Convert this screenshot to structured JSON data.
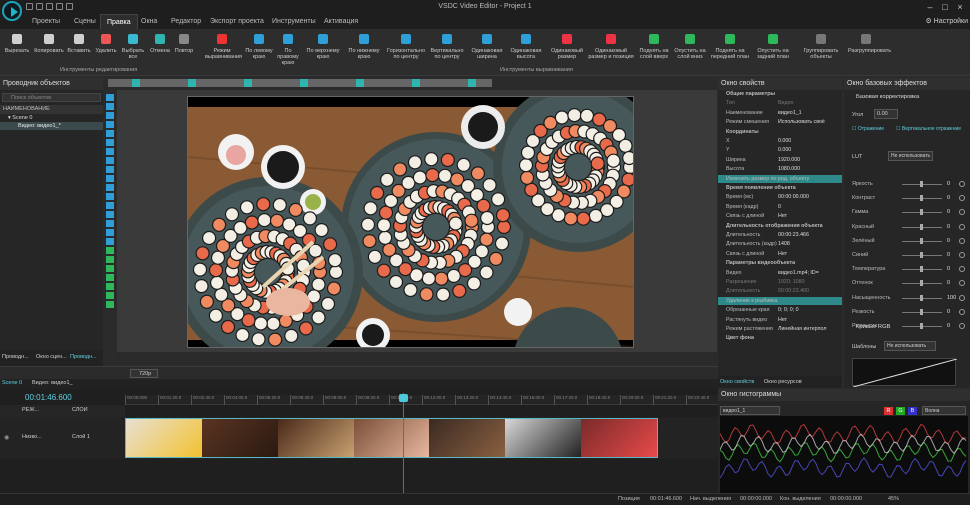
{
  "window": {
    "title": "VSDC Video Editor - Project 1",
    "settings": "Настройки"
  },
  "menu": [
    "Проекты",
    "Сцены",
    "Правка",
    "Окна",
    "Редактор",
    "Экспорт проекта",
    "Инструменты",
    "Активация"
  ],
  "ribbon": {
    "buttons": [
      "Вырезать",
      "Копировать",
      "Вставить",
      "Удалить",
      "Выбрать все",
      "Отмена",
      "Повтор",
      "Режим выравнивания",
      "По левому краю",
      "По правому краю",
      "По верхнему краю",
      "По нижнему краю",
      "Горизонтально по центру",
      "Вертикально по центру",
      "Одинаковая ширина",
      "Одинаковая высота",
      "Одинаковый размер",
      "Одинаковый размер и позиция",
      "Поднять на слой вверх",
      "Опустить на слой вниз",
      "Поднять на передний план",
      "Опустить на задний план",
      "Группировать объекты",
      "Разгруппировать"
    ],
    "groups": [
      "Инструменты редактирования",
      "Инструменты выравнивания"
    ]
  },
  "explorer": {
    "title": "Проводник объектов",
    "search": "Поиск объектов",
    "header": "НАИМЕНОВАНИЕ",
    "scene": "Scene 0",
    "item": "Видео: видео1_*",
    "tab1": "Проводн...",
    "tab2": "Окно сцен...",
    "tab3": "Проводн..."
  },
  "props": {
    "title": "Окно свойств",
    "rows": [
      {
        "k": "Общие параметры",
        "v": "",
        "t": "sect"
      },
      {
        "k": "Тип",
        "v": "Видео",
        "t": "dim"
      },
      {
        "k": "Наименование",
        "v": "видео1_1",
        "t": ""
      },
      {
        "k": "Режим смешения",
        "v": "Использовать своё",
        "t": ""
      },
      {
        "k": "Координаты",
        "v": "",
        "t": "sect"
      },
      {
        "k": "X",
        "v": "0.000",
        "t": ""
      },
      {
        "k": "Y",
        "v": "0.000",
        "t": ""
      },
      {
        "k": "Ширина",
        "v": "1920.000",
        "t": ""
      },
      {
        "k": "Высота",
        "v": "1080.000",
        "t": ""
      },
      {
        "k": "Изменить размер по род. объекту",
        "v": "",
        "t": "hl"
      },
      {
        "k": "Время появления объекта",
        "v": "",
        "t": "sect"
      },
      {
        "k": "Время (мс)",
        "v": "00:00:00.000",
        "t": ""
      },
      {
        "k": "Время (кадр)",
        "v": "0",
        "t": ""
      },
      {
        "k": "Связь с длиной",
        "v": "Нет",
        "t": ""
      },
      {
        "k": "Длительность отображения объекта",
        "v": "",
        "t": "sect"
      },
      {
        "k": "Длительность",
        "v": "00:00:23.466",
        "t": ""
      },
      {
        "k": "Длительность (кадр)",
        "v": "1408",
        "t": ""
      },
      {
        "k": "Связь с длиной",
        "v": "Нет",
        "t": ""
      },
      {
        "k": "Параметры видеообъекта",
        "v": "",
        "t": "sect"
      },
      {
        "k": "Видео",
        "v": "видео1.mp4; ID=",
        "t": ""
      },
      {
        "k": "Разрешение",
        "v": "1920; 1080",
        "t": "dim"
      },
      {
        "k": "Длительность",
        "v": "00:00:23.400",
        "t": "dim"
      },
      {
        "k": "Удаление к разбивка",
        "v": "",
        "t": "hl"
      },
      {
        "k": "Обрезанные края",
        "v": "0; 0; 0; 0",
        "t": ""
      },
      {
        "k": "Растянуть видео",
        "v": "Нет",
        "t": ""
      },
      {
        "k": "Режим растяжения",
        "v": "Линейная интерпол",
        "t": ""
      },
      {
        "k": "Цвет фона",
        "v": "",
        "t": "sect"
      }
    ],
    "tab1": "Окно свойств",
    "tab2": "Окно ресурсов"
  },
  "effects": {
    "title": "Окно базовых эффектов",
    "section": "Базовая корректировка",
    "yac": "Угол",
    "yacval": "0.00",
    "chk1": "Отражение",
    "chk2": "Вертикальное отражение",
    "lut": "LUT",
    "lutval": "Не использовать",
    "rows": [
      {
        "k": "Яркость",
        "v": "0"
      },
      {
        "k": "Контраст",
        "v": "0"
      },
      {
        "k": "Гамма",
        "v": "0"
      },
      {
        "k": "Красный",
        "v": "0"
      },
      {
        "k": "Зелёный",
        "v": "0"
      },
      {
        "k": "Синий",
        "v": "0"
      },
      {
        "k": "Температура",
        "v": "0"
      },
      {
        "k": "Оттенок",
        "v": "0"
      },
      {
        "k": "Насыщенность",
        "v": "100"
      },
      {
        "k": "Резкость",
        "v": "0"
      },
      {
        "k": "Размытие",
        "v": "0"
      }
    ],
    "curves": "Кривые RGB",
    "templates": "Шаблоны",
    "templval": "Не использовать",
    "rgb": [
      "R",
      "G",
      "B"
    ],
    "all": "Всё"
  },
  "histo": {
    "title": "Окно гистограммы",
    "src": "видео1_1",
    "mode": "Волна"
  },
  "playback": {
    "zoom": "720p"
  },
  "timeline": {
    "tab1": "Scene 0",
    "tab2": "Видео: видео1_",
    "timecode": "00:01:46.600",
    "hdr1": "РЕЖ...",
    "hdr2": "СЛОИ",
    "layername": "Слой 1",
    "track": "Низко...",
    "ticks": [
      "00:00:000",
      "00:01:20.0",
      "00:02:40.0",
      "00:04:00.0",
      "00:05:20.0",
      "00:06:40.0",
      "00:08:00.0",
      "00:09:20.0",
      "00:10:40.0",
      "00:12:00.0",
      "00:13:20.0",
      "00:14:40.0",
      "00:16:00.0",
      "00:17:20.0",
      "00:18:40.0",
      "00:20:00.0",
      "00:21:20.0",
      "00:22:40.0"
    ]
  },
  "status": {
    "pos_l": "Позиция",
    "pos": "00:01:46.600",
    "start_l": "Нач. выделения",
    "start": "00:00:00.000",
    "end_l": "Кон. выделения",
    "end": "00:00:00.000",
    "zoom": "45%"
  }
}
